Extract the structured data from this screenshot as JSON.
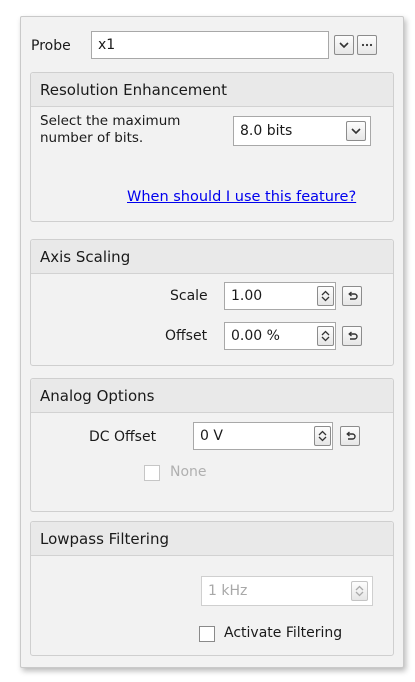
{
  "probe": {
    "label": "Probe",
    "value": "x1"
  },
  "resolution": {
    "title": "Resolution Enhancement",
    "description": "Select the maximum number of bits.",
    "bits_value": "8.0 bits",
    "help_link": "When should I use this feature?"
  },
  "axis_scaling": {
    "title": "Axis Scaling",
    "scale_label": "Scale",
    "scale_value": "1.00",
    "offset_label": "Offset",
    "offset_value": "0.00 %"
  },
  "analog_options": {
    "title": "Analog Options",
    "dc_offset_label": "DC Offset",
    "dc_offset_value": "0 V",
    "none_label": "None"
  },
  "lowpass": {
    "title": "Lowpass Filtering",
    "frequency_value": "1 kHz",
    "activate_label": "Activate Filtering"
  },
  "colors": {
    "link": "#0000ee",
    "disabled_text": "#a8a8a8",
    "panel_bg": "#f2f2f2"
  }
}
